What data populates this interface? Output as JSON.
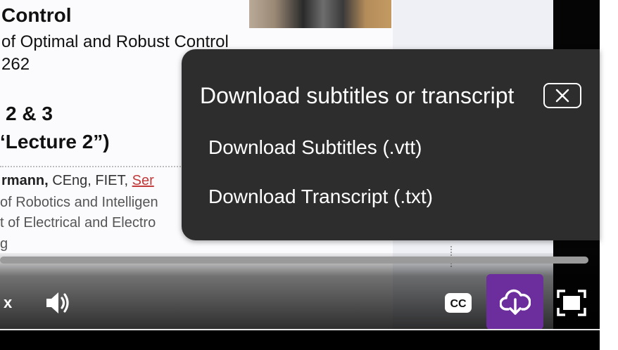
{
  "slide": {
    "title": "Control",
    "subtitle_line1": "of Optimal and Robust Control",
    "subtitle_line2": "262",
    "lecture_line1": "2 & 3",
    "lecture_line2": "‘Lecture 2”)",
    "author_name": "rmann,",
    "author_creds": " CEng, FIET, ",
    "author_trunc": "Ser",
    "affiliation_line1": "of Robotics and Intelligen",
    "affiliation_line2": "t of Electrical and Electro",
    "affiliation_line3": "g"
  },
  "popup": {
    "title": "Download subtitles or transcript",
    "items": [
      {
        "label": "Download Subtitles (.vtt)"
      },
      {
        "label": "Download Transcript (.txt)"
      }
    ],
    "close_icon": "close-icon"
  },
  "controls": {
    "speed_label": "x",
    "icons": [
      "volume-icon",
      "closed-captions-icon",
      "cloud-download-icon",
      "fullscreen-icon"
    ],
    "accent_color": "#6b2e9c"
  }
}
